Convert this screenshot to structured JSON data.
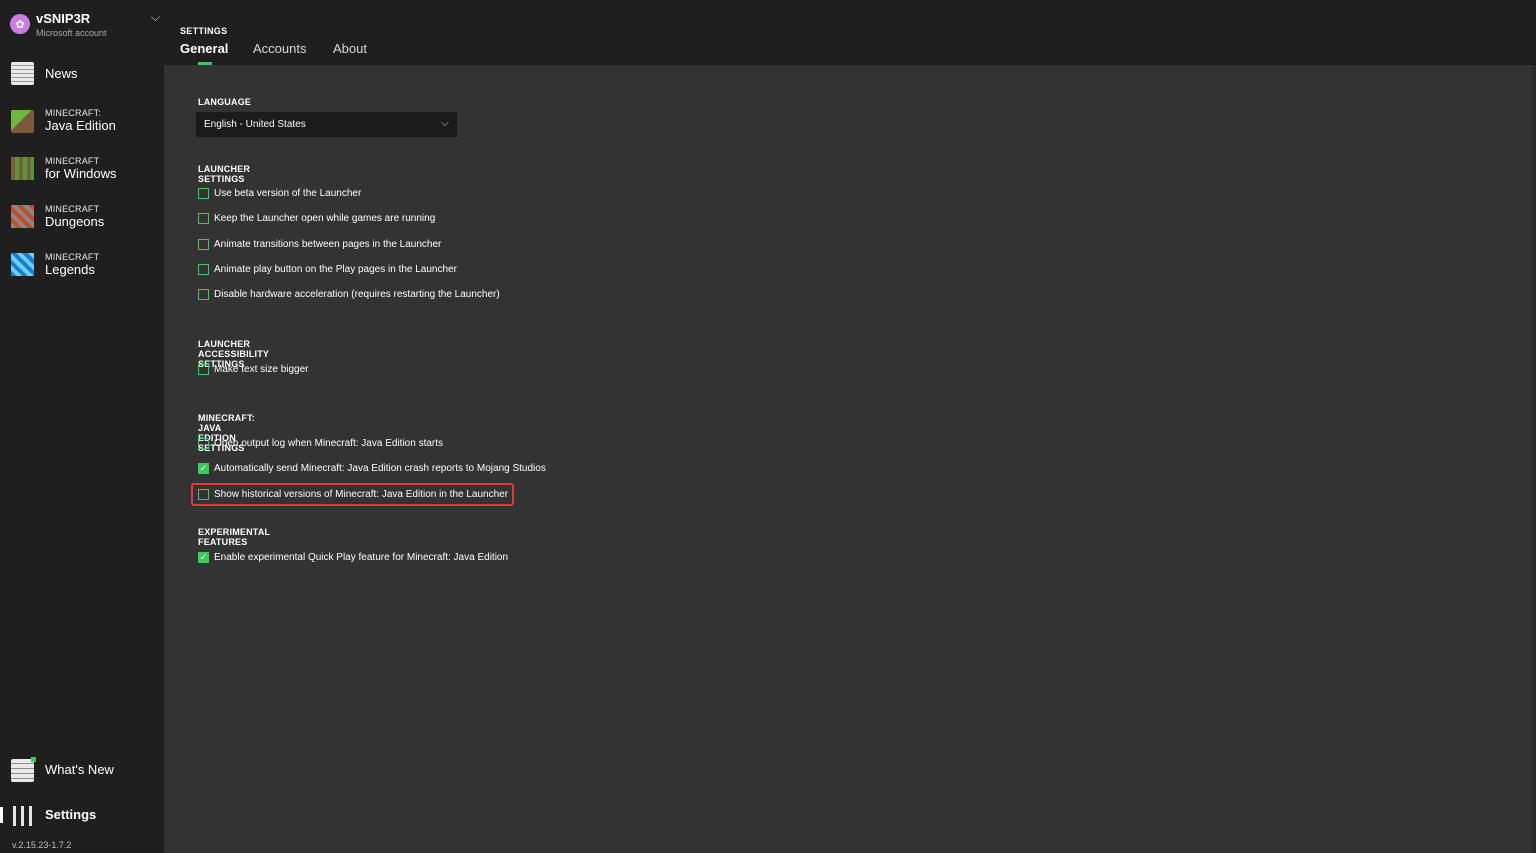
{
  "account": {
    "name": "vSNIP3R",
    "type": "Microsoft account"
  },
  "sidebar": {
    "news": "News",
    "java": {
      "small": "MINECRAFT:",
      "big": "Java Edition"
    },
    "windows": {
      "small": "MINECRAFT",
      "big": "for Windows"
    },
    "dungeons": {
      "small": "MINECRAFT",
      "big": "Dungeons"
    },
    "legends": {
      "small": "MINECRAFT",
      "big": "Legends"
    },
    "whats_new": "What's New",
    "settings": "Settings",
    "version": "v.2.15.23-1.7.2"
  },
  "header": {
    "crumb": "SETTINGS",
    "tabs": [
      "General",
      "Accounts",
      "About"
    ]
  },
  "language": {
    "title": "LANGUAGE",
    "selected": "English - United States"
  },
  "launcher_settings": {
    "title": "LAUNCHER SETTINGS",
    "options": [
      {
        "label": "Use beta version of the Launcher",
        "checked": false
      },
      {
        "label": "Keep the Launcher open while games are running",
        "checked": false
      },
      {
        "label": "Animate transitions between pages in the Launcher",
        "checked": false
      },
      {
        "label": "Animate play button on the Play pages in the Launcher",
        "checked": false
      },
      {
        "label": "Disable hardware acceleration (requires restarting the Launcher)",
        "checked": false
      }
    ]
  },
  "accessibility": {
    "title": "LAUNCHER ACCESSIBILITY SETTINGS",
    "options": [
      {
        "label": "Make text size bigger",
        "checked": false
      }
    ]
  },
  "java_settings": {
    "title": "MINECRAFT: JAVA EDITION SETTINGS",
    "options": [
      {
        "label": "Open output log when Minecraft: Java Edition starts",
        "checked": false
      },
      {
        "label": "Automatically send Minecraft: Java Edition crash reports to Mojang Studios",
        "checked": true
      },
      {
        "label": "Show historical versions of Minecraft: Java Edition in the Launcher",
        "checked": false
      }
    ]
  },
  "experimental": {
    "title": "EXPERIMENTAL FEATURES",
    "options": [
      {
        "label": "Enable experimental Quick Play feature for Minecraft: Java Edition",
        "checked": true
      }
    ]
  },
  "colors": {
    "accent": "#3cca5c",
    "highlight": "#e03a3a",
    "sidebar_bg": "#1f1f1f",
    "content_bg": "#333333"
  }
}
